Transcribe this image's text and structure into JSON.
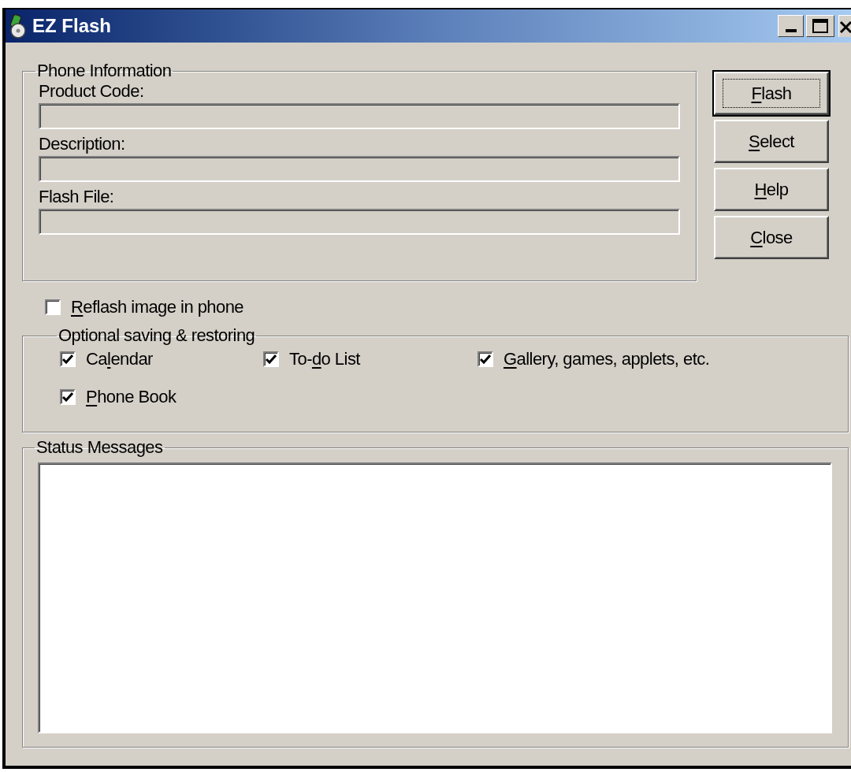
{
  "window": {
    "title": "EZ Flash"
  },
  "phone_information": {
    "title": "Phone Information",
    "fields": [
      {
        "label": "Product Code:"
      },
      {
        "label": "Description:"
      },
      {
        "label": "Flash File:"
      }
    ]
  },
  "buttons": [
    {
      "key": "F",
      "post": "lash",
      "default": true
    },
    {
      "key": "S",
      "post": "elect",
      "default": false
    },
    {
      "key": "H",
      "post": "elp",
      "default": false
    },
    {
      "key": "C",
      "post": "lose",
      "default": false
    }
  ],
  "reflash": {
    "key": "R",
    "post": "eflash image in phone",
    "checked": false
  },
  "optional": {
    "title": "Optional saving & restoring",
    "options": [
      {
        "pre": "Ca",
        "key": "l",
        "post": "endar",
        "checked": true
      },
      {
        "pre": "To-",
        "key": "d",
        "post": "o List",
        "checked": true
      },
      {
        "key": "G",
        "post": "allery, games, applets, etc.",
        "checked": true
      },
      {
        "key": "P",
        "post": "hone Book",
        "checked": true
      }
    ]
  },
  "status": {
    "title": "Status Messages"
  }
}
